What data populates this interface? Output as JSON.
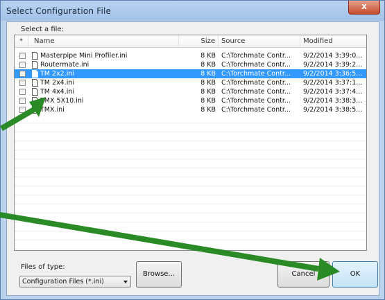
{
  "window": {
    "title": "Select Configuration File",
    "close_label": "x"
  },
  "select_label": "Select a file:",
  "columns": [
    {
      "key": "check",
      "label": "*"
    },
    {
      "key": "name",
      "label": "Name"
    },
    {
      "key": "size",
      "label": "Size"
    },
    {
      "key": "source",
      "label": "Source"
    },
    {
      "key": "modified",
      "label": "Modified"
    }
  ],
  "files": [
    {
      "name": "Masterpipe Mini Profiler.ini",
      "size": "8 KB",
      "source": "C:\\Torchmate Contr...",
      "modified": "9/2/2014 3:39:0...",
      "selected": false
    },
    {
      "name": "Routermate.ini",
      "size": "8 KB",
      "source": "C:\\Torchmate Contr...",
      "modified": "9/2/2014 3:39:2...",
      "selected": false
    },
    {
      "name": "TM 2x2.ini",
      "size": "8 KB",
      "source": "C:\\Torchmate Contr...",
      "modified": "9/2/2014 3:36:5...",
      "selected": true
    },
    {
      "name": "TM 2x4.ini",
      "size": "8 KB",
      "source": "C:\\Torchmate Contr...",
      "modified": "9/2/2014 3:37:1...",
      "selected": false
    },
    {
      "name": "TM 4x4.ini",
      "size": "8 KB",
      "source": "C:\\Torchmate Contr...",
      "modified": "9/2/2014 3:37:4...",
      "selected": false
    },
    {
      "name": "TMX 5X10.ini",
      "size": "8 KB",
      "source": "C:\\Torchmate Contr...",
      "modified": "9/2/2014 3:38:3...",
      "selected": false
    },
    {
      "name": "TMX.ini",
      "size": "8 KB",
      "source": "C:\\Torchmate Contr...",
      "modified": "9/2/2014 3:38:5...",
      "selected": false
    }
  ],
  "files_of_type": {
    "label": "Files of type:",
    "value": "Configuration Files (*.ini)"
  },
  "buttons": {
    "browse": "Browse...",
    "cancel": "Cancel",
    "ok": "OK"
  },
  "colors": {
    "selection": "#3399ff",
    "annotation_arrow": "#2a8a26",
    "titlebar": "#b8d2f0"
  }
}
